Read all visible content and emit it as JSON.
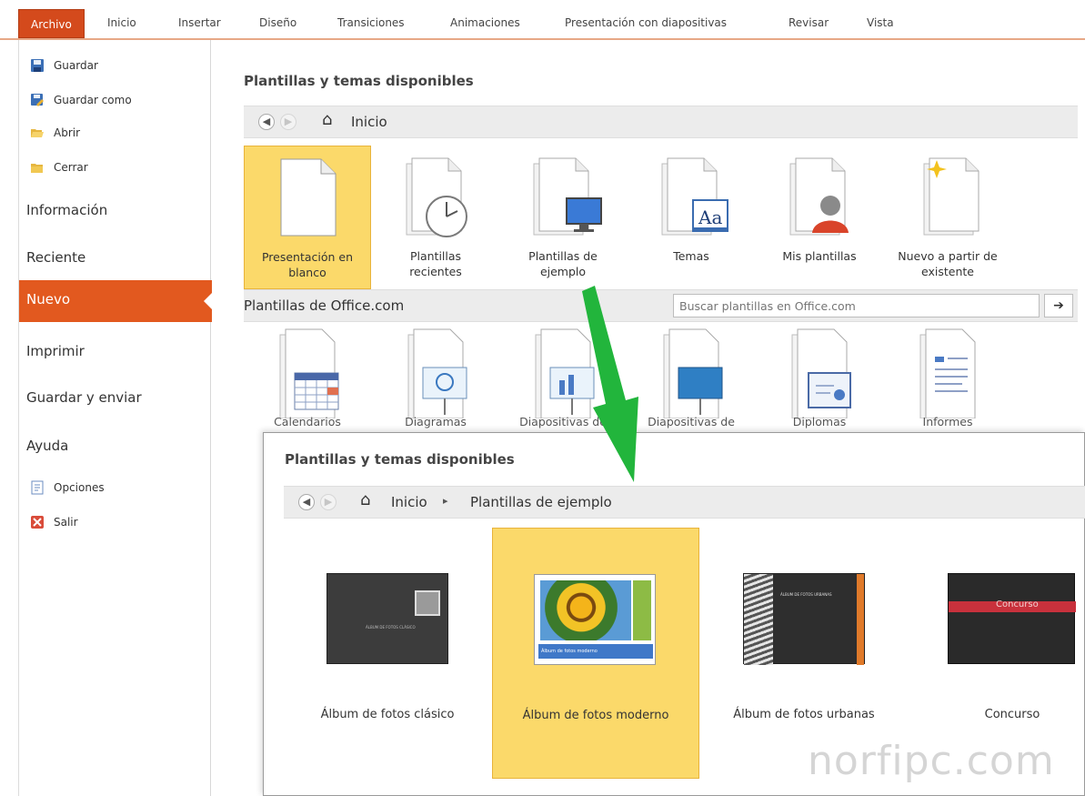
{
  "ribbon": {
    "tabs": [
      "Archivo",
      "Inicio",
      "Insertar",
      "Diseño",
      "Transiciones",
      "Animaciones",
      "Presentación con diapositivas",
      "Revisar",
      "Vista"
    ]
  },
  "backstage": {
    "commands_top": [
      {
        "label": "Guardar",
        "icon": "save-icon"
      },
      {
        "label": "Guardar como",
        "icon": "save-as-icon"
      },
      {
        "label": "Abrir",
        "icon": "open-folder-icon"
      },
      {
        "label": "Cerrar",
        "icon": "close-folder-icon"
      }
    ],
    "items": [
      "Información",
      "Reciente",
      "Nuevo",
      "Imprimir",
      "Guardar y enviar",
      "Ayuda"
    ],
    "selected": "Nuevo",
    "commands_bottom": [
      {
        "label": "Opciones",
        "icon": "options-icon"
      },
      {
        "label": "Salir",
        "icon": "exit-icon"
      }
    ]
  },
  "main": {
    "title": "Plantillas y temas disponibles",
    "nav_location": "Inicio",
    "tiles": [
      {
        "line1": "Presentación en",
        "line2": "blanco"
      },
      {
        "line1": "Plantillas",
        "line2": "recientes"
      },
      {
        "line1": "Plantillas de",
        "line2": "ejemplo"
      },
      {
        "line1": "Temas",
        "line2": ""
      },
      {
        "line1": "Mis plantillas",
        "line2": ""
      },
      {
        "line1": "Nuevo a partir de",
        "line2": "existente"
      }
    ],
    "office_section_title": "Plantillas de Office.com",
    "search_placeholder": "Buscar plantillas en Office.com",
    "search_go": "➔",
    "office_tiles": [
      "Calendarios",
      "Diagramas",
      "Diapositivas de",
      "Diapositivas de",
      "Diplomas",
      "Informes"
    ]
  },
  "overlay": {
    "title": "Plantillas y temas disponibles",
    "breadcrumb_home": "Inicio",
    "breadcrumb_sep": "▸",
    "breadcrumb_current": "Plantillas de ejemplo",
    "templates": [
      {
        "label": "Álbum de fotos clásico",
        "thumb_text": "ÁLBUM DE FOTOS CLÁSICO"
      },
      {
        "label": "Álbum de fotos moderno",
        "thumb_text": "Álbum de fotos moderno"
      },
      {
        "label": "Álbum de fotos urbanas",
        "thumb_text": "ÁLBUM DE FOTOS URBANAS"
      },
      {
        "label": "Concurso",
        "thumb_text": "Concurso"
      }
    ],
    "selected_index": 1
  },
  "watermark": "norfipc.com",
  "colors": {
    "accent": "#e2591f",
    "selection": "#fbd96a",
    "arrow": "#22b53c"
  }
}
